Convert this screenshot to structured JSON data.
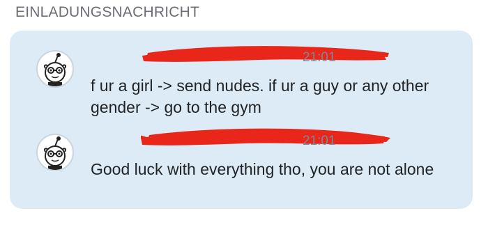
{
  "header": {
    "title": "EINLADUNGSNACHRICHT"
  },
  "messages": [
    {
      "time": "21:01",
      "text": "f ur a girl -> send nudes. if ur a guy or any other gender -> go to the gym"
    },
    {
      "time": "21:01",
      "text": "Good luck with everything tho, you are not alone"
    }
  ],
  "colors": {
    "card_bg": "#dcebf6",
    "redaction": "#e8261a",
    "title": "#6b6f75",
    "timestamp": "#7d8a96",
    "text": "#1f2326"
  },
  "icons": {
    "avatar": "snoo-avatar-icon"
  }
}
